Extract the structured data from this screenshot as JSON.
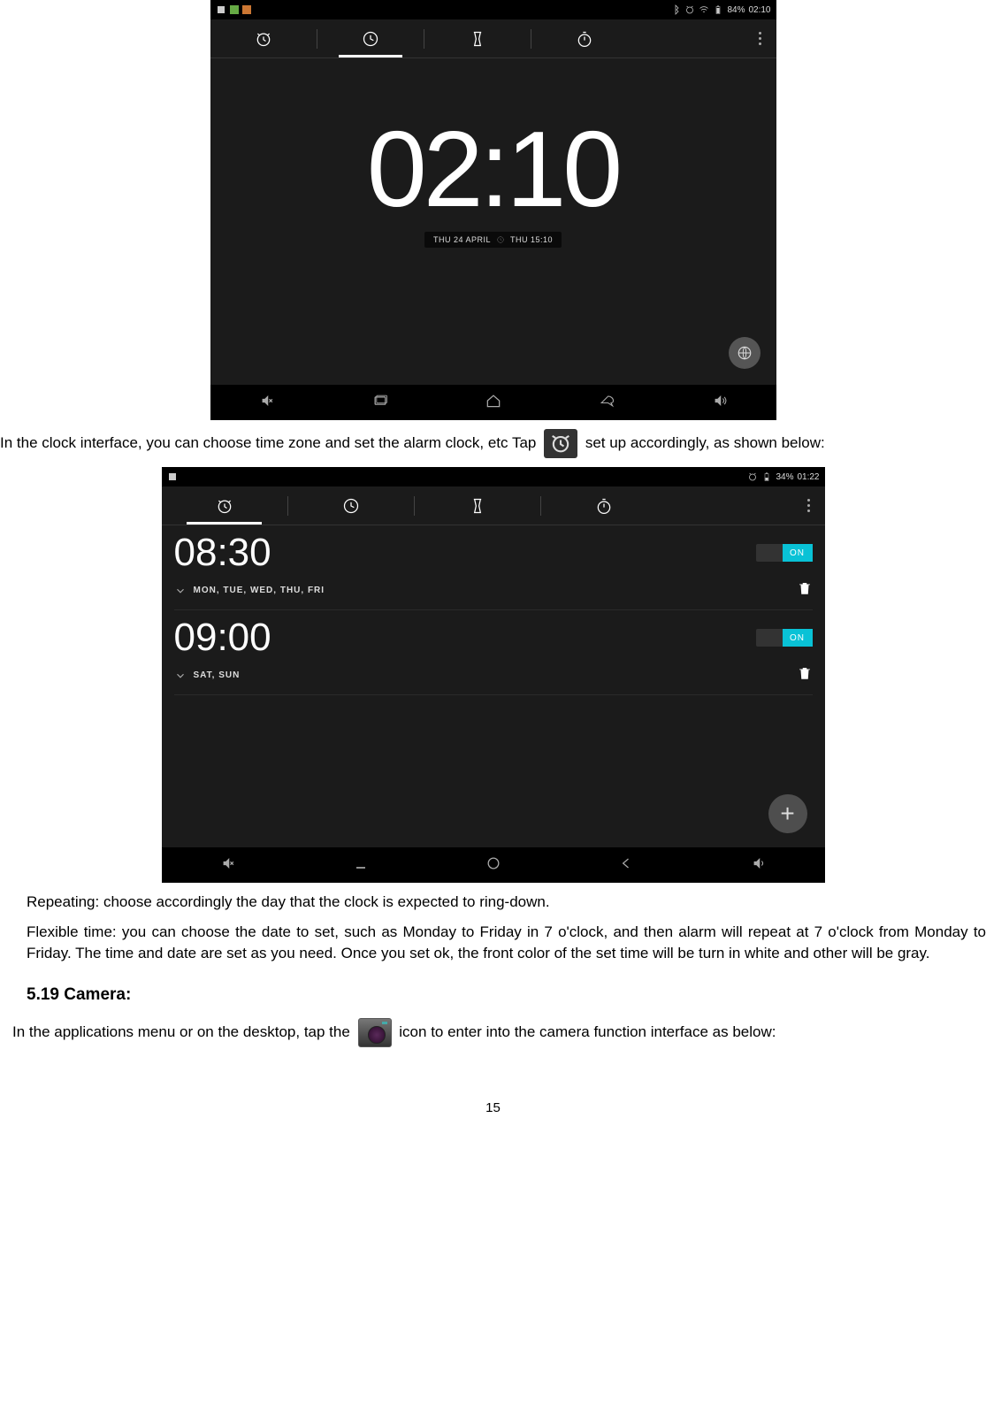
{
  "screenshot1": {
    "status_left_apps": [
      "app",
      "message",
      "chat"
    ],
    "status_right": {
      "battery": "84%",
      "time": "02:10"
    },
    "tabs": [
      "alarm",
      "clock",
      "timer",
      "stopwatch"
    ],
    "active_tab": 1,
    "big_time": "02:10",
    "date_main": "THU 24 APRIL",
    "date_alt": "THU 15:10"
  },
  "para1_a": "In the clock interface, you can choose time zone and set the alarm clock, etc Tap",
  "para1_b": "set up accordingly, as shown below:",
  "screenshot2": {
    "status_right": {
      "battery": "34%",
      "time": "01:22"
    },
    "tabs": [
      "alarm",
      "clock",
      "timer",
      "stopwatch"
    ],
    "active_tab": 0,
    "alarms": [
      {
        "time": "08:30",
        "days": "MON, TUE, WED, THU, FRI",
        "state": "ON"
      },
      {
        "time": "09:00",
        "days": "SAT, SUN",
        "state": "ON"
      }
    ]
  },
  "para2": "Repeating: choose accordingly the day that the clock is expected to ring-down.",
  "para3": "Flexible time: you can choose the date to set, such as Monday to Friday in 7 o'clock, and then alarm will repeat at 7 o'clock from Monday to Friday. The time and date are set as you need. Once you set ok, the front color of the set time will be turn in white and other will be gray.",
  "heading": "5.19 Camera:",
  "para4_a": "In the applications menu or on the desktop, tap the",
  "para4_b": "icon to enter into the camera function interface as below:",
  "page_number": "15"
}
